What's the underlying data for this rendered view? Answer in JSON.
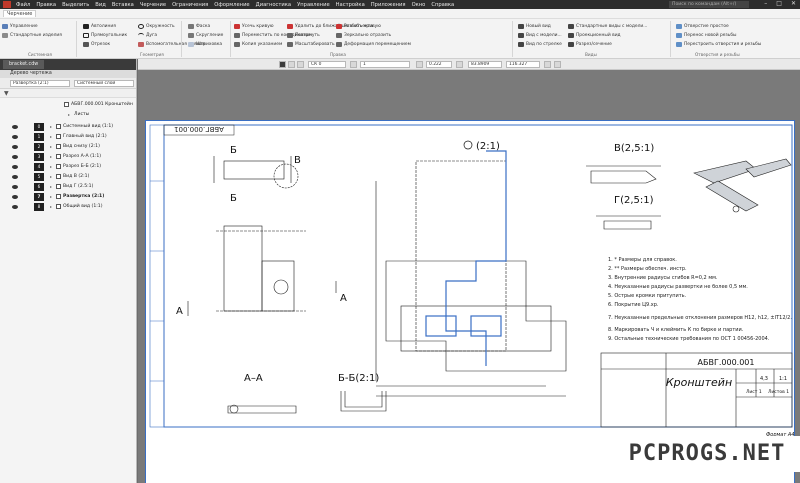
{
  "titlebar": {
    "menu": [
      "Файл",
      "Правка",
      "Выделить",
      "Вид",
      "Вставка",
      "Черчение",
      "Ограничения",
      "Оформление",
      "Диагностика",
      "Управление",
      "Настройка",
      "Приложения",
      "Окно",
      "Справка"
    ],
    "search_placeholder": "Поиск по командам (Alt+/)",
    "doc_tab": "bracket.cdw"
  },
  "ribbon": {
    "tabs": [
      "Черчение"
    ],
    "left_commands": [
      "Управление",
      "Стандартные изделия"
    ],
    "commands": [
      {
        "label": "Автолиния"
      },
      {
        "label": "Прямоугольник"
      },
      {
        "label": "Отрезок"
      },
      {
        "label": "Окружность"
      },
      {
        "label": "Дуга"
      },
      {
        "label": "Вспомогательная прямая"
      },
      {
        "label": "Фаска"
      },
      {
        "label": "Скругление"
      },
      {
        "label": "Штриховка"
      },
      {
        "label": "Усечь кривую"
      },
      {
        "label": "Переместить по координатам"
      },
      {
        "label": "Копия указанием"
      },
      {
        "label": "Удалить до ближайшего объекта"
      },
      {
        "label": "Повернуть"
      },
      {
        "label": "Масштабировать"
      },
      {
        "label": "Разбить кривую"
      },
      {
        "label": "Зеркально отразить"
      },
      {
        "label": "Деформация перемещением"
      },
      {
        "label": "Новый вид"
      },
      {
        "label": "Вид с модели..."
      },
      {
        "label": "Вид по стрелке"
      },
      {
        "label": "Стандартные виды с модели..."
      },
      {
        "label": "Проекционный вид"
      },
      {
        "label": "Разрез/сечение"
      },
      {
        "label": "Отверстие простое"
      },
      {
        "label": "Перенос новой резьбы"
      },
      {
        "label": "Перестроить отверстия и резьбы"
      }
    ],
    "groups": [
      "Системная",
      "Геометрия",
      "Правка",
      "Виды",
      "Отверстия и резьбы"
    ]
  },
  "toolbar2": {
    "style": "СК 0",
    "layer": "1",
    "zoom": "0.222",
    "x": "83.8909",
    "y": "116.327"
  },
  "tree": {
    "title": "Дерево чертежа",
    "filter": "Развертка (2:1)",
    "layer_filter": "Системный слой",
    "root": "АБВГ.000.001 Кронштейн",
    "sheets": "Листы",
    "views": [
      {
        "num": "0",
        "label": "Системный вид (1:1)"
      },
      {
        "num": "1",
        "label": "Главный вид (2:1)"
      },
      {
        "num": "2",
        "label": "Вид снизу (2:1)"
      },
      {
        "num": "3",
        "label": "Разрез А-А (1:1)"
      },
      {
        "num": "4",
        "label": "Разрез Б-Б (2:1)"
      },
      {
        "num": "5",
        "label": "Вид В (2:1)"
      },
      {
        "num": "6",
        "label": "Вид Г (2.5:1)"
      },
      {
        "num": "7",
        "label": "Развертка (2:1)"
      },
      {
        "num": "8",
        "label": "Общий вид (1:1)"
      }
    ]
  },
  "drawing": {
    "sheet_code_top": "АБВГ.000.001",
    "labels": {
      "b_top": "Б",
      "b_bottom": "Б",
      "v": "В",
      "a_left": "А",
      "a_right": "А",
      "section_aa": "А–А",
      "section_bb": "Б-Б(2:1)",
      "razvertka": "(2:1)",
      "view_v": "В(2,5:1)",
      "view_g": "Г(2,5:1)"
    },
    "notes": [
      "1. * Размеры для справок.",
      "2. ** Размеры обеспеч. инстр.",
      "3. Внутренние радиусы сгибов R=0,2 мм.",
      "4. Неуказанные радиусы развертки не более 0,5 мм.",
      "5. Острые кромки притупить.",
      "6. Покрытие Ц9.хр.",
      "7. Неуказанные предельные отклонения размеров H12, h12, ±IT12/2.",
      "8. Маркировать Ч и клеймить К по бирке и партии.",
      "9. Остальные технические требования по ОСТ 1 00456-2004."
    ],
    "title_block": {
      "code": "АБВГ.000.001",
      "name": "Кронштейн",
      "mass": "4,3",
      "scale": "1:1",
      "sheet": "Лист 1",
      "sheets": "Листов 1",
      "format": "Формат  А4"
    },
    "colors": {
      "accent": "#3a6fc4",
      "line": "#1a1a1a"
    }
  },
  "watermark": "PCPROGS.NET"
}
